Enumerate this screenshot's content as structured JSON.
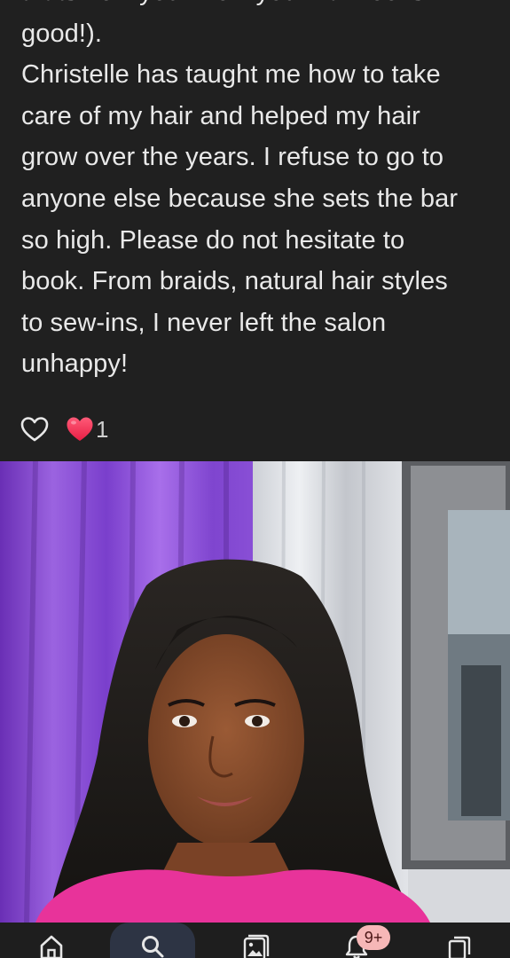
{
  "review": {
    "lines": [
      "thats how you know your hair looks",
      "good!).",
      "Christelle has taught me how to take",
      "care of my hair and helped my hair",
      "grow over the years. I refuse to go to",
      "anyone else because she sets the bar",
      "so high. Please do not hesitate to",
      "book. From braids, natural hair styles",
      "to sew-ins, I never left the salon",
      "unhappy!"
    ]
  },
  "reactions": {
    "like_icon": "heart-outline-icon",
    "reaction_icon": "red-heart-icon",
    "count": "1",
    "heart_color": "#ff3b5c"
  },
  "photo": {
    "description_icon": "photo"
  },
  "bottom_nav": {
    "items": [
      {
        "icon": "home-icon"
      },
      {
        "icon": "search-icon",
        "selected": true
      },
      {
        "icon": "photos-icon"
      },
      {
        "icon": "bell-icon"
      },
      {
        "icon": "tabs-icon"
      }
    ],
    "notification_badge": "9+",
    "accent": "#2d3444"
  }
}
